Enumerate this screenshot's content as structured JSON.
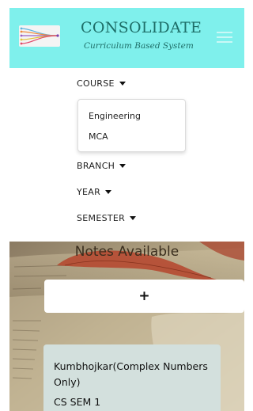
{
  "brand": {
    "title": "CONSOLIDATE",
    "subtitle": "Curriculum Based System",
    "logo_icon": "network-lines-logo",
    "colors": {
      "navbar": "#7ff0ec",
      "brand_text": "#1e6e68"
    }
  },
  "nav": {
    "course": "COURSE",
    "course_options": [
      "Engineering",
      "MCA"
    ],
    "branch": "BRANCH",
    "year": "YEAR",
    "semester": "SEMESTER",
    "toggler_icon": "hamburger-menu-icon"
  },
  "notes": {
    "heading": "Notes Available",
    "add_label": "+",
    "cards": [
      {
        "title": "Kumbhojkar(Complex Numbers Only)",
        "subtitle": "CS SEM 1"
      }
    ]
  }
}
